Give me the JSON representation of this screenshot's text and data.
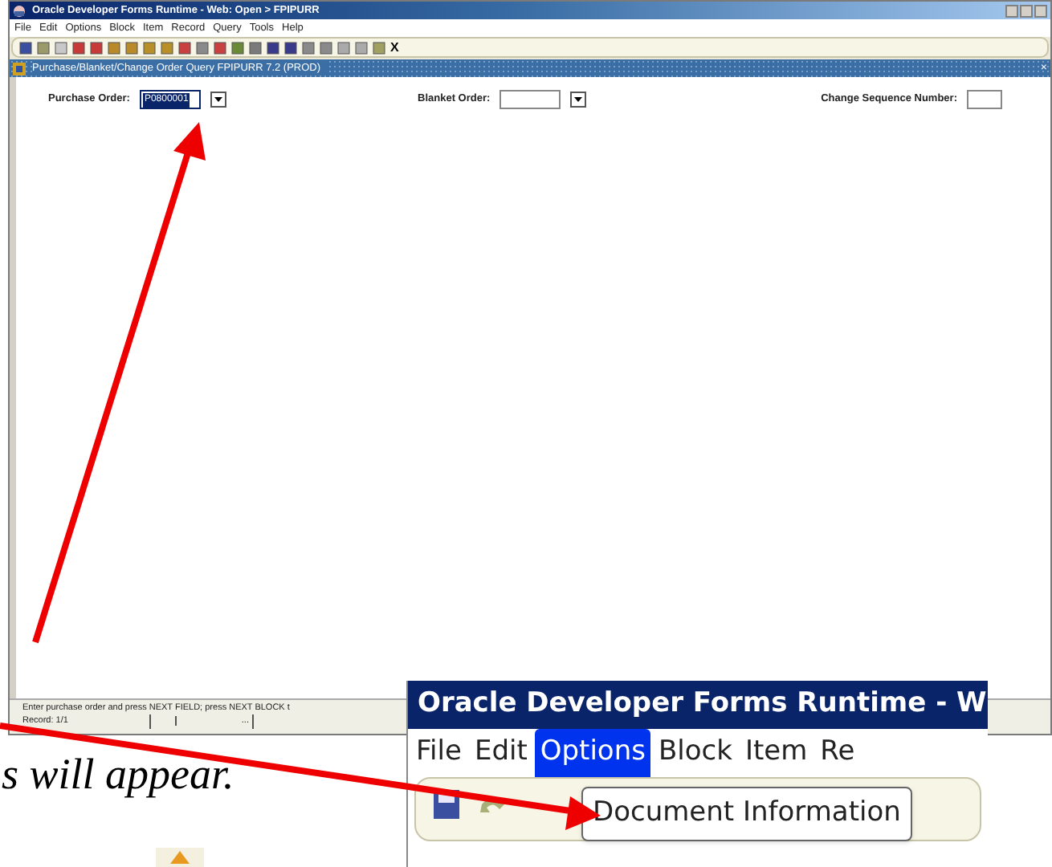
{
  "window": {
    "title": "Oracle Developer Forms Runtime - Web: Open > FPIPURR"
  },
  "menu": [
    {
      "label": "File"
    },
    {
      "label": "Edit"
    },
    {
      "label": "Options"
    },
    {
      "label": "Block"
    },
    {
      "label": "Item"
    },
    {
      "label": "Record"
    },
    {
      "label": "Query"
    },
    {
      "label": "Tools"
    },
    {
      "label": "Help"
    }
  ],
  "toolbar": {
    "exit_label": "X"
  },
  "form": {
    "title": "Purchase/Blanket/Change Order Query  FPIPURR  7.2  (PROD)",
    "fields": [
      {
        "label": "Purchase Order:",
        "value": "P0800001",
        "selected": true,
        "kind": "dropdown"
      },
      {
        "label": "Blanket Order:",
        "selected": false,
        "kind": "dropdown"
      },
      {
        "label": "Change Sequence Number:",
        "selected": false,
        "kind": "text"
      }
    ],
    "close_label": "×"
  },
  "status_bar": {
    "message": "Enter purchase order and press NEXT FIELD; press NEXT BLOCK t",
    "record": "Record: 1/1",
    "segment": "..."
  },
  "document_text": "s will appear.",
  "inset": {
    "title": "Oracle Developer Forms Runtime - W",
    "menu": [
      {
        "label": "File",
        "selected": false
      },
      {
        "label": "Edit",
        "selected": false
      },
      {
        "label": "Options",
        "selected": true
      },
      {
        "label": "Block",
        "selected": false
      },
      {
        "label": "Item",
        "selected": false
      },
      {
        "label": "Re",
        "selected": false
      }
    ],
    "dropdown_item": "Document Information"
  }
}
